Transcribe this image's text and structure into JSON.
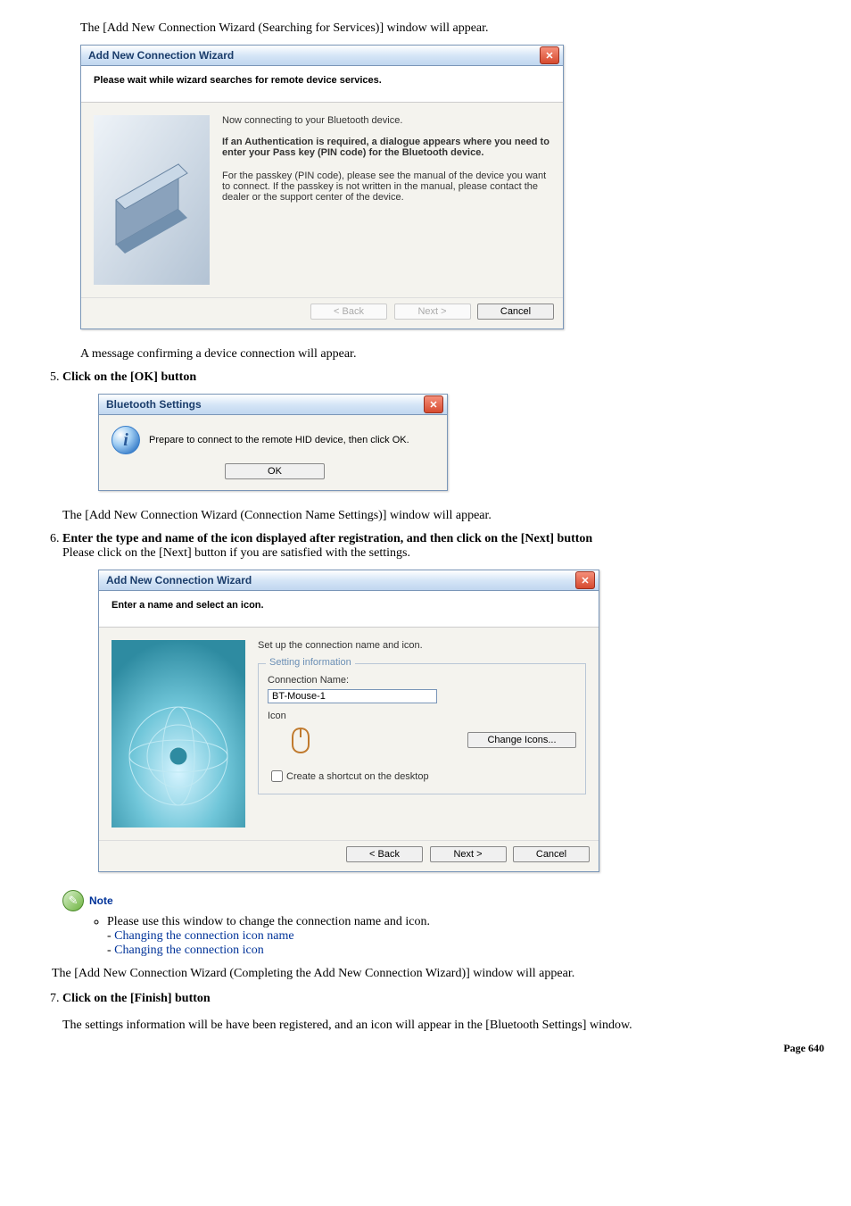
{
  "intro_text": "The [Add New Connection Wizard (Searching for Services)] window will appear.",
  "wizard1": {
    "title": "Add New Connection Wizard",
    "header": "Please wait while wizard searches for remote device services.",
    "line1": "Now connecting to your Bluetooth device.",
    "bold_block": "If an Authentication is required, a dialogue appears where you need to enter your Pass key (PIN code) for the Bluetooth device.",
    "line2": "For the passkey (PIN code), please see the manual of the device you want to connect. If the passkey is not written in the manual, please contact the dealer or the support center of the device.",
    "back": "< Back",
    "next": "Next >",
    "cancel": "Cancel"
  },
  "after_wizard1": "A message confirming a device connection will appear.",
  "step5": {
    "label": "Click on the [OK] button"
  },
  "msgbox": {
    "title": "Bluetooth Settings",
    "text": "Prepare to connect to the remote HID device, then click OK.",
    "ok": "OK"
  },
  "after_msgbox": "The [Add New Connection Wizard (Connection Name Settings)] window will appear.",
  "step6": {
    "label": "Enter the type and name of the icon displayed after registration, and then click on the [Next] button",
    "detail": "Please click on the [Next] button if you are satisfied with the settings."
  },
  "wizard2": {
    "title": "Add New Connection Wizard",
    "header": "Enter a name and select an icon.",
    "intro": "Set up the connection name and icon.",
    "legend": "Setting information",
    "conn_label": "Connection Name:",
    "conn_value": "BT-Mouse-1",
    "icon_label": "Icon",
    "change_icons": "Change Icons...",
    "checkbox_label": "Create a shortcut on the desktop",
    "back": "< Back",
    "next": "Next >",
    "cancel": "Cancel"
  },
  "note": {
    "label": "Note",
    "bullet_intro": "Please use this window to change the connection name and icon.",
    "link1_prefix": "- ",
    "link1": "Changing the connection icon name",
    "link2_prefix": "- ",
    "link2": "Changing the connection icon"
  },
  "after_note": "The [Add New Connection Wizard (Completing the Add New Connection Wizard)] window will appear.",
  "step7": {
    "label": "Click on the [Finish] button",
    "detail": "The settings information will be have been registered, and an icon will appear in the [Bluetooth Settings] window."
  },
  "page_footer": "Page 640"
}
